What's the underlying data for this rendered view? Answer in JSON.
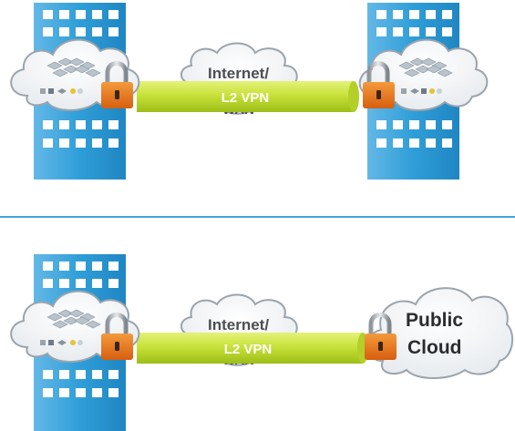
{
  "scenarios": [
    {
      "network_cloud_label": "Internet/",
      "network_cloud_label_partial": "WAN",
      "tunnel_label": "L2 VPN",
      "right_endpoint": "datacenter"
    },
    {
      "network_cloud_label": "Internet/",
      "network_cloud_label_partial": "WAN",
      "tunnel_label": "L2 VPN",
      "right_endpoint": "public-cloud",
      "public_cloud_line1": "Public",
      "public_cloud_line2": "Cloud"
    }
  ],
  "colors": {
    "building": "#2e9bd3",
    "building_light": "#7cc6ee",
    "window": "#ffffff",
    "tunnel": "#c9e23a",
    "tunnel_dark": "#9fbf1f",
    "lock_body": "#e8731c",
    "divider": "#3fa3dc",
    "cloud_fill": "#ffffff",
    "cloud_stroke": "#9aa4ad"
  }
}
